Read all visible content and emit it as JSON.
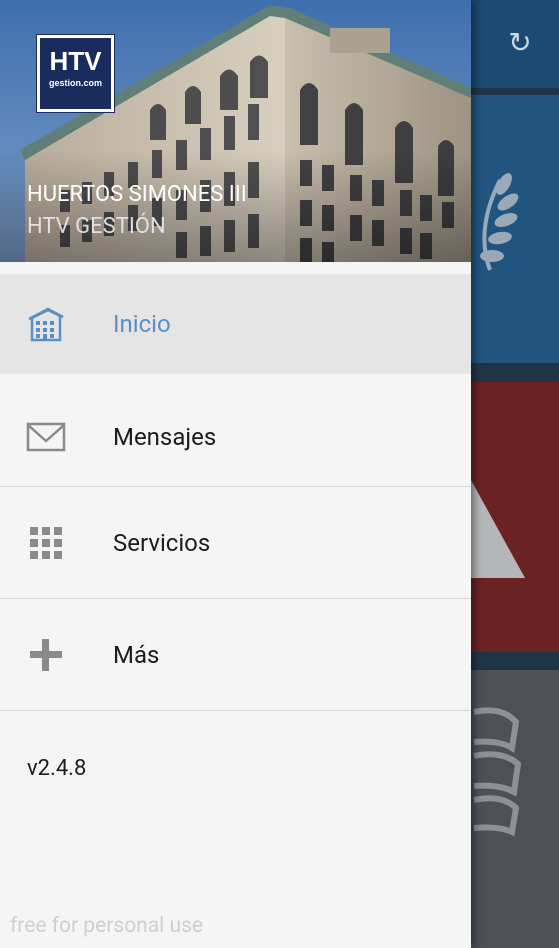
{
  "background_app": {
    "refresh_icon": "refresh-icon",
    "tiles": [
      "blue-tile",
      "red-tile",
      "gray-tile"
    ]
  },
  "drawer": {
    "header": {
      "logo_main": "HTV",
      "logo_sub": "gestion.com",
      "title": "HUERTOS SIMONES III",
      "subtitle": "HTV GESTIÓN"
    },
    "items": [
      {
        "label": "Inicio",
        "icon": "building-icon",
        "active": true
      },
      {
        "label": "Mensajes",
        "icon": "envelope-icon",
        "active": false
      },
      {
        "label": "Servicios",
        "icon": "grid-icon",
        "active": false
      },
      {
        "label": "Más",
        "icon": "plus-icon",
        "active": false
      }
    ],
    "version": "v2.4.8"
  },
  "watermark": "free for personal use",
  "colors": {
    "accent": "#5b8fc4",
    "drawer_bg": "#f5f5f5",
    "active_bg": "#e5e5e5",
    "icon_gray": "#8a8a8a"
  }
}
